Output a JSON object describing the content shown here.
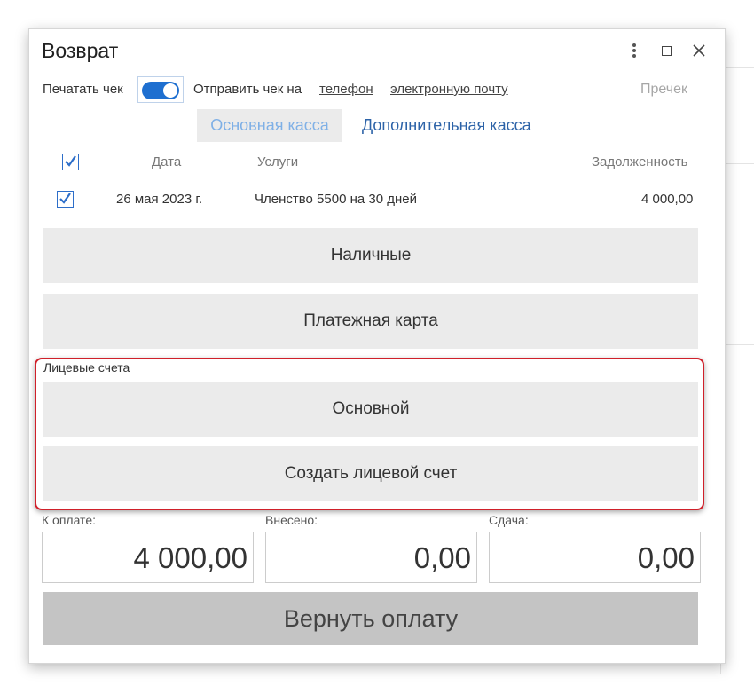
{
  "dialog": {
    "title": "Возврат"
  },
  "print": {
    "label": "Печатать чек",
    "toggle_on": true,
    "send_label": "Отправить чек на",
    "phone_link": "телефон",
    "email_link": "электронную почту",
    "reprint": "Пречек"
  },
  "tabs": {
    "main": "Основная касса",
    "extra": "Дополнительная касса"
  },
  "table": {
    "headers": {
      "date": "Дата",
      "services": "Услуги",
      "debt": "Задолженность"
    },
    "rows": [
      {
        "checked": true,
        "date": "26 мая 2023 г.",
        "service": "Членство 5500 на 30 дней",
        "debt": "4 000,00"
      }
    ]
  },
  "payment": {
    "cash": "Наличные",
    "card": "Платежная карта",
    "accounts_label": "Лицевые счета",
    "main_account": "Основной",
    "create_account": "Создать лицевой счет"
  },
  "totals": {
    "to_pay_label": "К оплате:",
    "to_pay": "4 000,00",
    "paid_label": "Внесено:",
    "paid": "0,00",
    "change_label": "Сдача:",
    "change": "0,00"
  },
  "actions": {
    "return": "Вернуть оплату"
  },
  "colors": {
    "accent": "#1e6fd0",
    "highlight": "#d0202a"
  }
}
